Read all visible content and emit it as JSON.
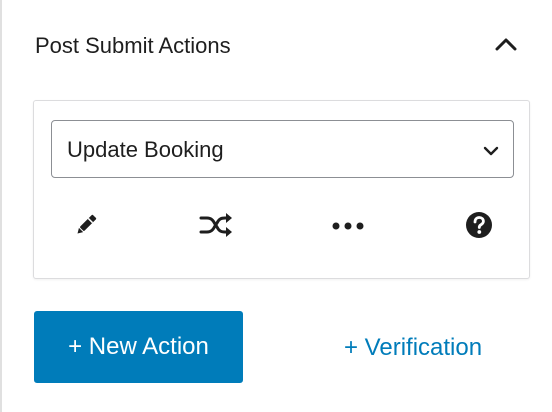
{
  "panel": {
    "title": "Post Submit Actions",
    "collapse_icon": "chevron-up-icon"
  },
  "action_card": {
    "select": {
      "value": "Update Booking",
      "arrow_icon": "chevron-down-icon"
    },
    "tools": [
      {
        "name": "edit",
        "icon": "pencil-icon"
      },
      {
        "name": "conditions",
        "icon": "shuffle-icon"
      },
      {
        "name": "more",
        "icon": "ellipsis-icon"
      },
      {
        "name": "help",
        "icon": "help-icon"
      }
    ]
  },
  "footer": {
    "new_action_label": "+ New Action",
    "verification_label": "+ Verification"
  },
  "colors": {
    "primary": "#007cba",
    "text": "#1e1e1e",
    "border": "#dcdcde"
  }
}
